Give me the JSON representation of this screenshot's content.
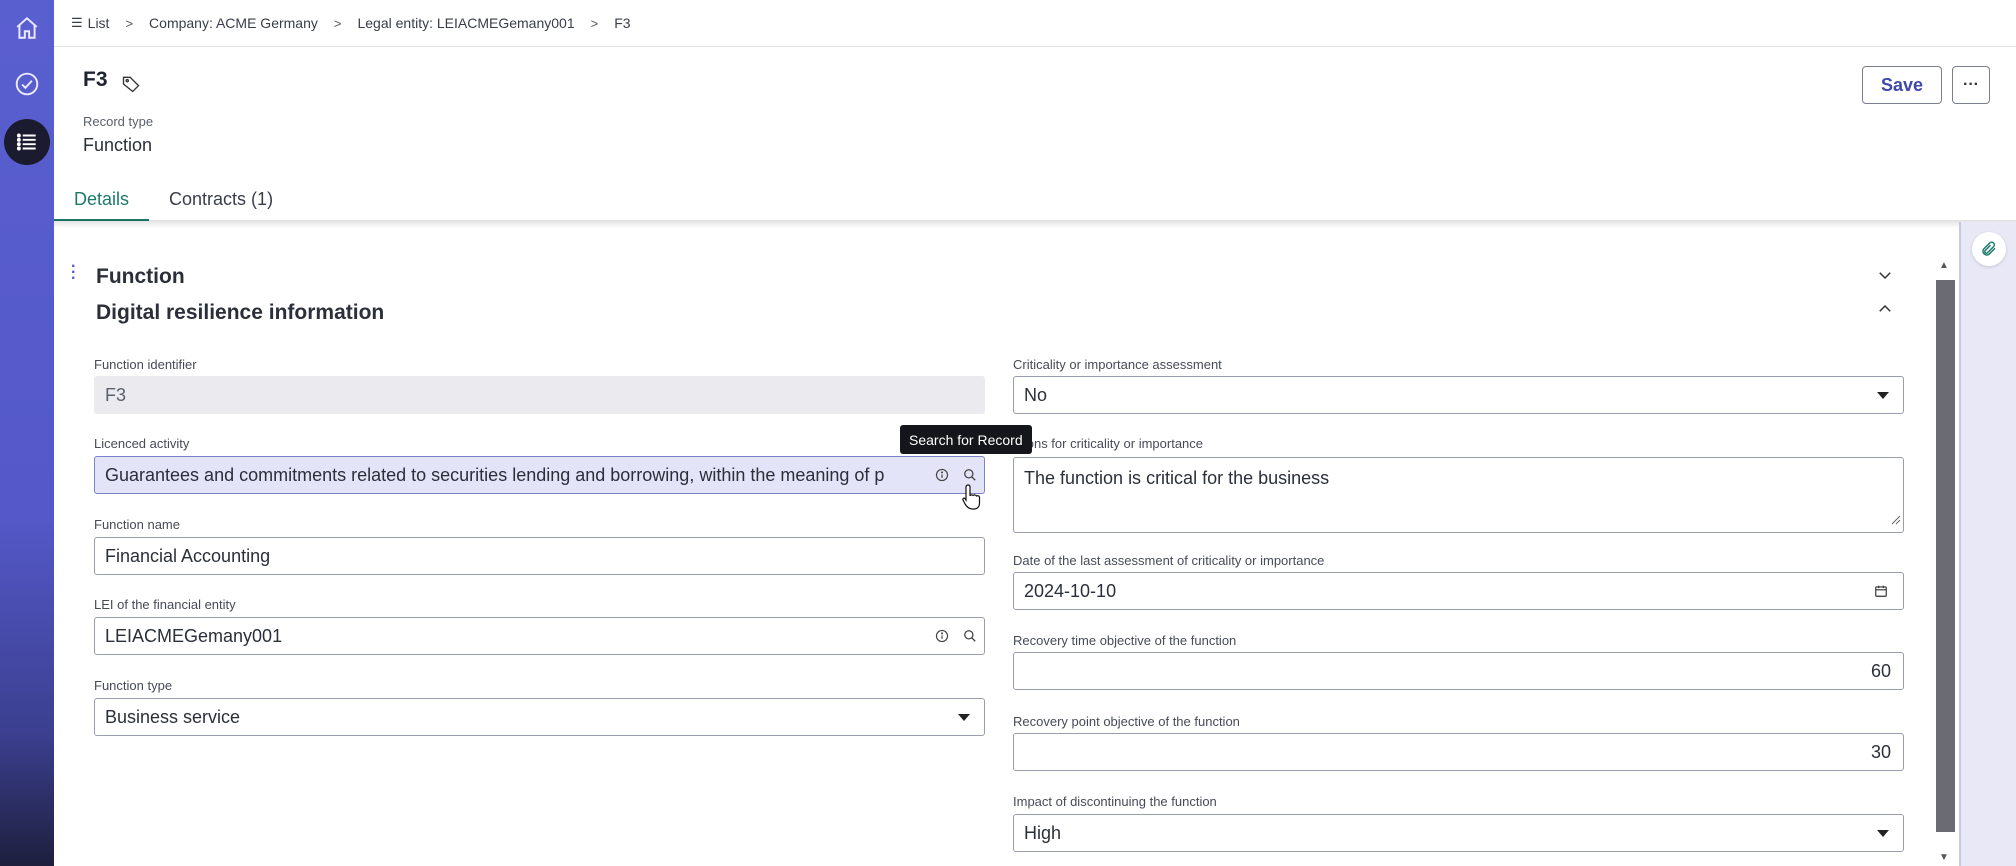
{
  "breadcrumb": {
    "items": [
      "List",
      "Company: ACME Germany",
      "Legal entity: LEIACMEGemany001",
      "F3"
    ]
  },
  "record": {
    "title": "F3",
    "record_type_label": "Record type",
    "record_type_value": "Function"
  },
  "toolbar": {
    "save_label": "Save",
    "more_label": "···"
  },
  "tabs": [
    {
      "label": "Details",
      "active": true
    },
    {
      "label": "Contracts (1)",
      "active": false
    }
  ],
  "sections": {
    "function_title": "Function",
    "digital_title": "Digital resilience information"
  },
  "tooltip": "Search for Record",
  "left_fields": {
    "function_identifier": {
      "label": "Function identifier",
      "value": "F3"
    },
    "licenced_activity": {
      "label": "Licenced activity",
      "value": "Guarantees and commitments related to securities lending and borrowing, within the meaning of p"
    },
    "function_name": {
      "label": "Function name",
      "value": "Financial Accounting"
    },
    "lei": {
      "label": "LEI of the financial entity",
      "value": "LEIACMEGemany001"
    },
    "function_type": {
      "label": "Function type",
      "value": "Business service"
    }
  },
  "right_fields": {
    "criticality": {
      "label": "Criticality or importance assessment",
      "value": "No"
    },
    "reasons": {
      "label": "asons for criticality or importance",
      "value": "The function is critical for the business"
    },
    "last_assessment": {
      "label": "Date of the last assessment of criticality or importance",
      "value": "2024-10-10"
    },
    "rto": {
      "label": "Recovery time objective of the function",
      "value": "60"
    },
    "rpo": {
      "label": "Recovery point objective of the function",
      "value": "30"
    },
    "impact": {
      "label": "Impact of discontinuing the function",
      "value": "High"
    }
  },
  "icons": [
    "home-icon",
    "check-circle-icon",
    "list-icon",
    "menu-list-icon",
    "chevron-right-icon",
    "tag-icon",
    "paperclip-icon",
    "info-icon",
    "search-icon",
    "calendar-icon",
    "chevron-down-icon",
    "chevron-up-icon",
    "drag-handle-icon",
    "resize-grip-icon",
    "pointer-cursor-icon"
  ],
  "colors": {
    "rail": "#5458c8",
    "active_tab": "#1c7a6b",
    "save_text": "#4048a8"
  }
}
